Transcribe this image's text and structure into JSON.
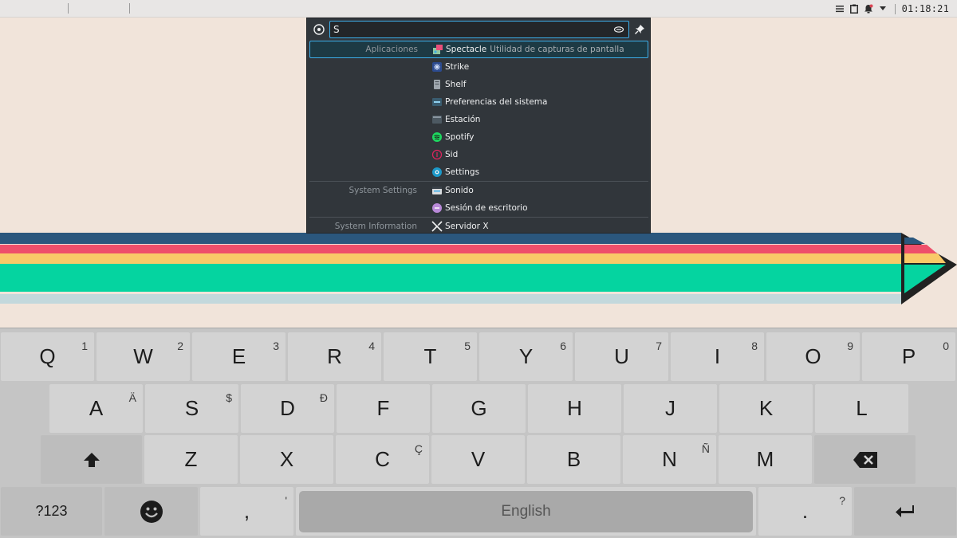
{
  "panel": {
    "clock": "01:18:21",
    "tray_icons": [
      "menu-icon",
      "clipboard-icon",
      "notifications-icon",
      "expand-icon"
    ]
  },
  "krunner": {
    "query": "S",
    "groups": [
      {
        "category": "Aplicaciones",
        "items": [
          {
            "name": "Spectacle",
            "subtext": "Utilidad de capturas de pantalla",
            "icon": "spectacle-icon",
            "selected": true
          },
          {
            "name": "Strike",
            "icon": "strike-icon"
          },
          {
            "name": "Shelf",
            "icon": "shelf-icon"
          },
          {
            "name": "Preferencias del sistema",
            "icon": "system-settings-icon"
          },
          {
            "name": "Estación",
            "icon": "estacion-icon"
          },
          {
            "name": "Spotify",
            "icon": "spotify-icon"
          },
          {
            "name": "Sid",
            "icon": "sid-icon"
          },
          {
            "name": "Settings",
            "icon": "settings-icon"
          }
        ]
      },
      {
        "category": "System Settings",
        "items": [
          {
            "name": "Sonido",
            "icon": "sound-icon"
          },
          {
            "name": "Sesión de escritorio",
            "icon": "desktop-session-icon"
          }
        ]
      },
      {
        "category": "System Information",
        "items": [
          {
            "name": "Servidor X",
            "icon": "x-server-icon"
          }
        ]
      }
    ]
  },
  "keyboard": {
    "row1": [
      {
        "k": "Q",
        "h": "1"
      },
      {
        "k": "W",
        "h": "2"
      },
      {
        "k": "E",
        "h": "3"
      },
      {
        "k": "R",
        "h": "4"
      },
      {
        "k": "T",
        "h": "5"
      },
      {
        "k": "Y",
        "h": "6"
      },
      {
        "k": "U",
        "h": "7"
      },
      {
        "k": "I",
        "h": "8"
      },
      {
        "k": "O",
        "h": "9"
      },
      {
        "k": "P",
        "h": "0"
      }
    ],
    "row2": [
      {
        "k": "A",
        "h": "Ä"
      },
      {
        "k": "S",
        "h": "$"
      },
      {
        "k": "D",
        "h": "Đ"
      },
      {
        "k": "F",
        "h": ""
      },
      {
        "k": "G",
        "h": ""
      },
      {
        "k": "H",
        "h": ""
      },
      {
        "k": "J",
        "h": ""
      },
      {
        "k": "K",
        "h": ""
      },
      {
        "k": "L",
        "h": ""
      }
    ],
    "row3": [
      {
        "k": "Z",
        "h": ""
      },
      {
        "k": "X",
        "h": ""
      },
      {
        "k": "C",
        "h": "Ç"
      },
      {
        "k": "V",
        "h": ""
      },
      {
        "k": "B",
        "h": ""
      },
      {
        "k": "N",
        "h": "Ñ"
      },
      {
        "k": "M",
        "h": ""
      }
    ],
    "symbols_label": "?123",
    "comma": {
      "k": ",",
      "h": "'"
    },
    "space_label": "English",
    "period": {
      "k": ".",
      "h": "?"
    }
  }
}
